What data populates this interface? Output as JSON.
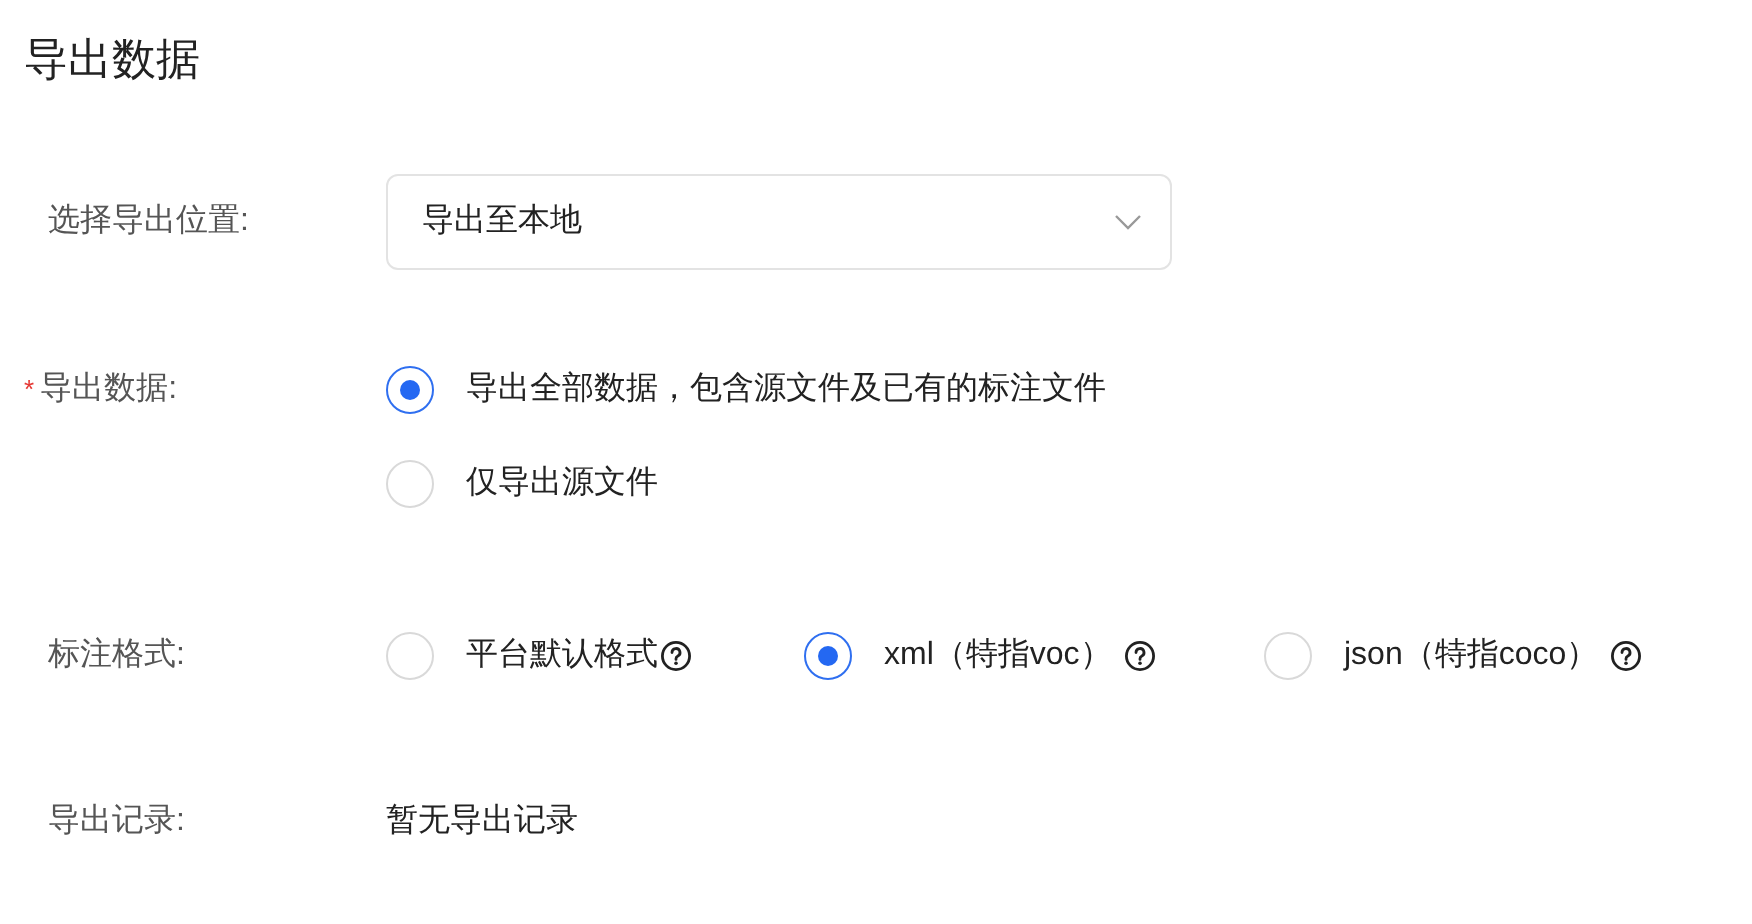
{
  "title": "导出数据",
  "location": {
    "label": "选择导出位置:",
    "value": "导出至本地"
  },
  "data": {
    "label": "导出数据:",
    "required_mark": "*",
    "options": [
      {
        "label": "导出全部数据，包含源文件及已有的标注文件",
        "selected": true
      },
      {
        "label": "仅导出源文件",
        "selected": false
      }
    ]
  },
  "format": {
    "label": "标注格式:",
    "options": [
      {
        "label": "平台默认格式",
        "selected": false
      },
      {
        "label": "xml（特指voc）",
        "selected": true
      },
      {
        "label": "json（特指coco）",
        "selected": false
      }
    ]
  },
  "records": {
    "label": "导出记录:",
    "value": "暂无导出记录"
  }
}
